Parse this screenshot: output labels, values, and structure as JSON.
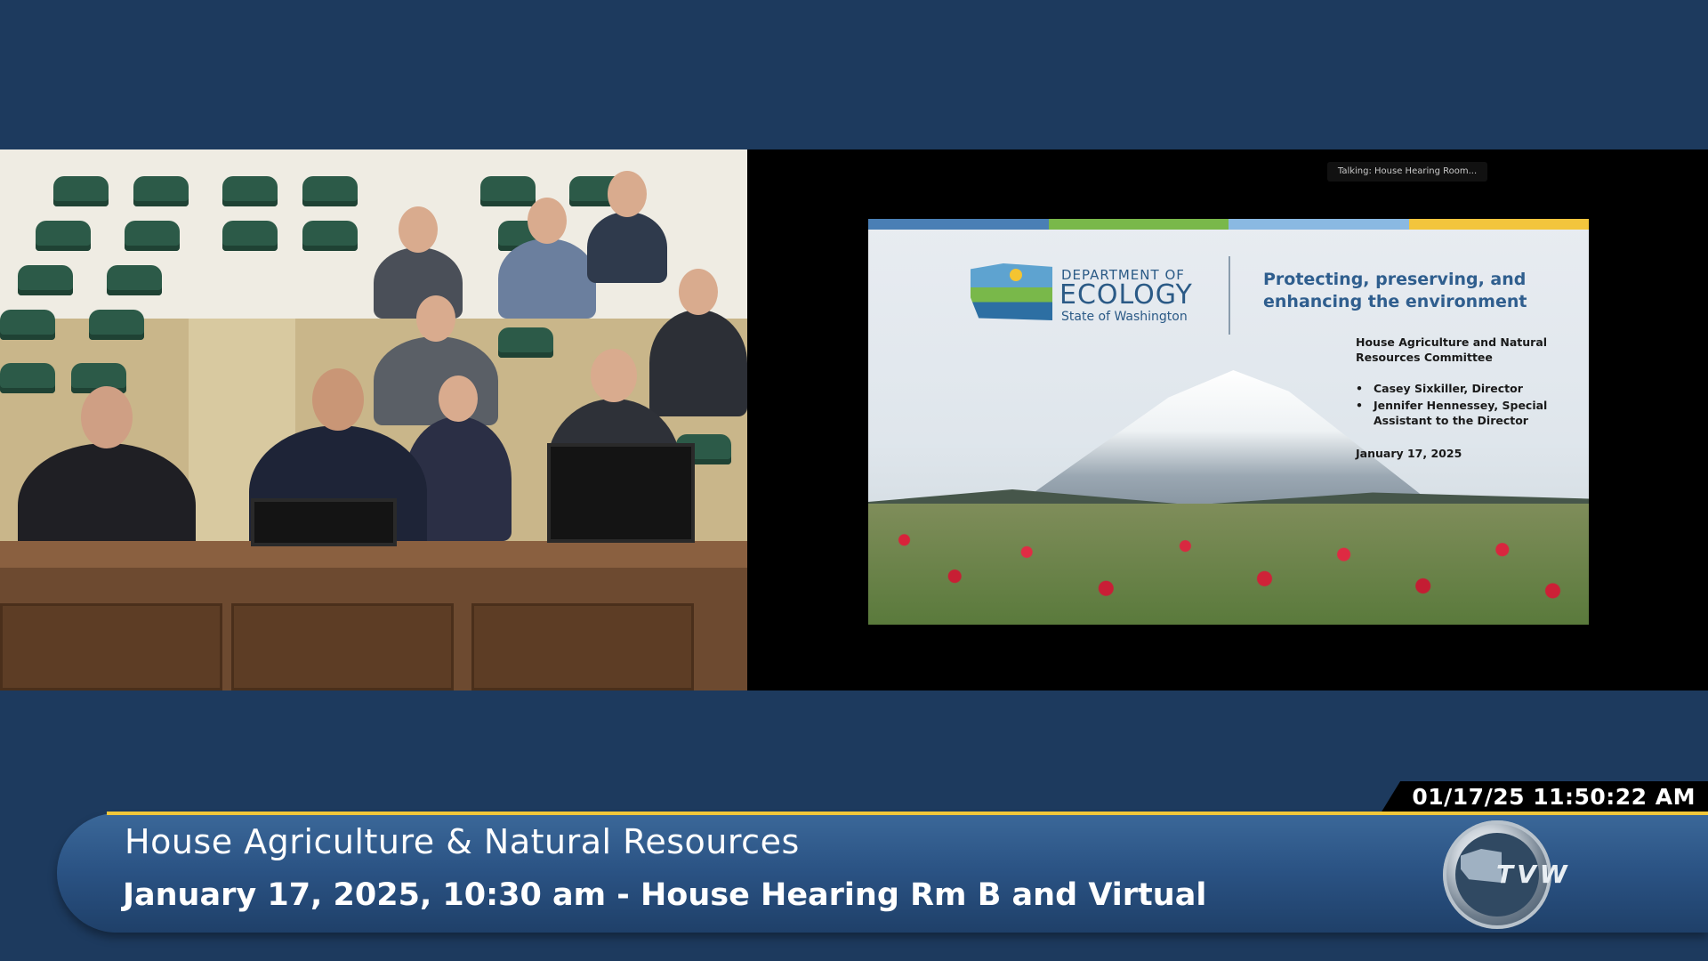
{
  "presentation": {
    "talking_indicator": "Talking: House Hearing Room...",
    "slide": {
      "bar_colors": [
        "#4a7fb5",
        "#79b84a",
        "#8ab9e2",
        "#f3c53d"
      ],
      "logo": {
        "line1": "DEPARTMENT OF",
        "line2": "ECOLOGY",
        "line3": "State of Washington"
      },
      "tagline": "Protecting, preserving, and enhancing the environment",
      "committee": "House Agriculture and Natural Resources Committee",
      "presenters": [
        "Casey Sixkiller, Director",
        "Jennifer Hennessey, Special Assistant to the Director"
      ],
      "date": "January 17, 2025"
    }
  },
  "broadcast": {
    "timestamp": "01/17/25 11:50:22 AM",
    "program_title": "House Agriculture & Natural Resources",
    "program_subtitle": "January 17, 2025, 10:30 am - House Hearing Rm B and Virtual",
    "network_logo": "TVW"
  },
  "colors": {
    "background": "#1d3a5e",
    "accent_gold": "#f1c73a",
    "ecology_blue": "#2f5e8e"
  }
}
